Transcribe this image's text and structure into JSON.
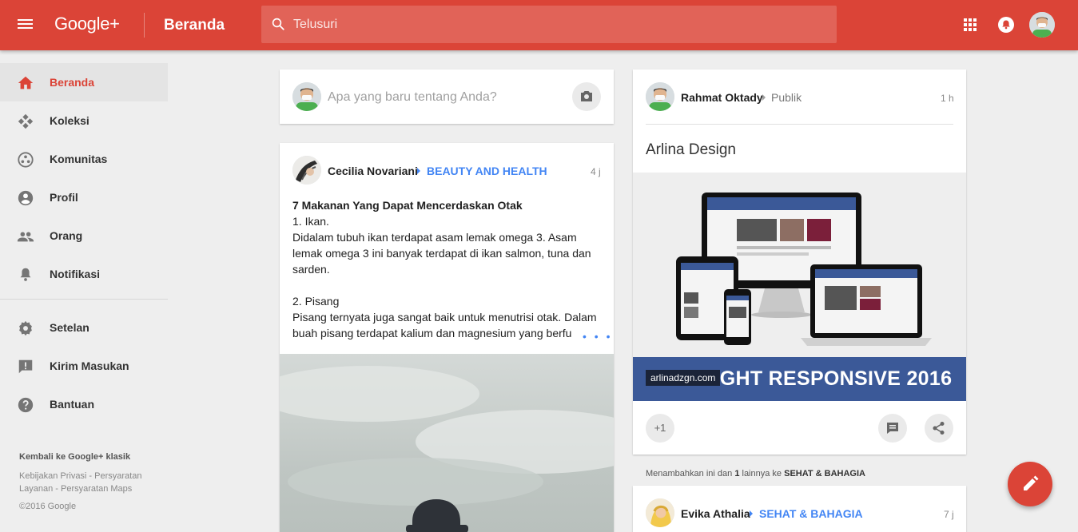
{
  "app": {
    "logo": "Google+",
    "page_title": "Beranda",
    "search_placeholder": "Telusuri"
  },
  "colors": {
    "brand": "#db4437",
    "link": "#4285f4"
  },
  "sidebar": {
    "items": [
      {
        "label": "Beranda",
        "icon": "home-icon",
        "active": true
      },
      {
        "label": "Koleksi",
        "icon": "collections-icon"
      },
      {
        "label": "Komunitas",
        "icon": "communities-icon"
      },
      {
        "label": "Profil",
        "icon": "profile-icon"
      },
      {
        "label": "Orang",
        "icon": "people-icon"
      },
      {
        "label": "Notifikasi",
        "icon": "bell-icon"
      },
      {
        "label": "Setelan",
        "icon": "gear-icon"
      },
      {
        "label": "Kirim Masukan",
        "icon": "feedback-icon"
      },
      {
        "label": "Bantuan",
        "icon": "help-icon"
      }
    ],
    "classic_link": "Kembali ke Google+ klasik",
    "footer_links": [
      "Kebijakan Privasi",
      "Persyaratan Layanan",
      "Persyaratan Maps"
    ],
    "copyright": "©2016 Google"
  },
  "compose": {
    "placeholder": "Apa yang baru tentang Anda?"
  },
  "posts": [
    {
      "author": "Cecilia Novariani",
      "community": "BEAUTY AND HEALTH",
      "time": "4 j",
      "lines": [
        "7 Makanan Yang Dapat Mencerdaskan Otak",
        "1. Ikan.",
        "Didalam tubuh ikan terdapat asam lemak omega 3. Asam lemak omega 3 ini banyak terdapat di ikan salmon, tuna dan sarden.",
        "",
        "2. Pisang",
        "Pisang ternyata juga sangat baik untuk menutrisi otak. Dalam buah pisang terdapat kalium dan magnesium yang berfu"
      ],
      "more": "• • •"
    },
    {
      "author": "Rahmat Oktady",
      "visibility": "Publik",
      "time": "1 h",
      "link_title": "Arlina Design",
      "banner_text": "ALLIGHT RESPONSIVE 2016",
      "banner_domain": "arlinadzgn.com",
      "plus_label": "+1"
    },
    {
      "author": "Evika Athalia",
      "community": "SEHAT & BAHAGIA",
      "time": "7 j"
    }
  ],
  "added_note": {
    "prefix": "Menambahkan ini dan",
    "count": "1",
    "middle": "lainnya ke",
    "target": "SEHAT & BAHAGIA"
  }
}
